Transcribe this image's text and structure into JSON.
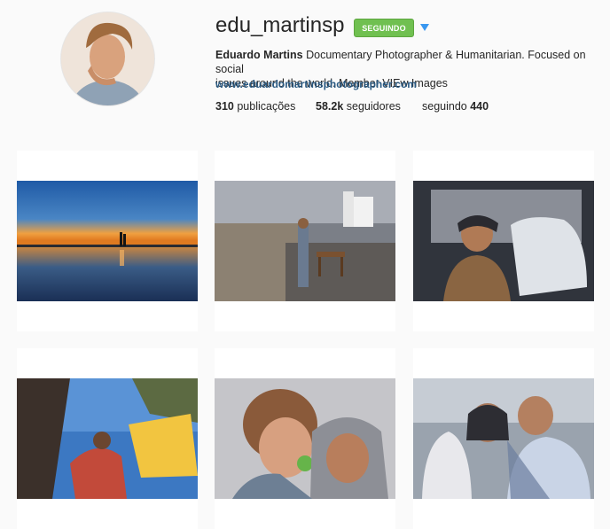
{
  "profile": {
    "username": "edu_martinsp",
    "follow_button": "SEGUINDO",
    "dropdown_icon": "caret-down-icon",
    "full_name": "Eduardo Martins",
    "bio_line1": "Documentary Photographer & Humanitarian. Focused on social",
    "bio_line2": "issues around the world. Member VIEw Images",
    "website": "www.eduardomartinsphotographer.com",
    "stats": {
      "posts_count": "310",
      "posts_label": "publicações",
      "followers_count": "58.2k",
      "followers_label": "seguidores",
      "following_label": "seguindo",
      "following_count": "440"
    }
  },
  "colors": {
    "follow_green": "#70c050",
    "link_blue": "#2a5a83",
    "caret_blue": "#3897f0"
  }
}
